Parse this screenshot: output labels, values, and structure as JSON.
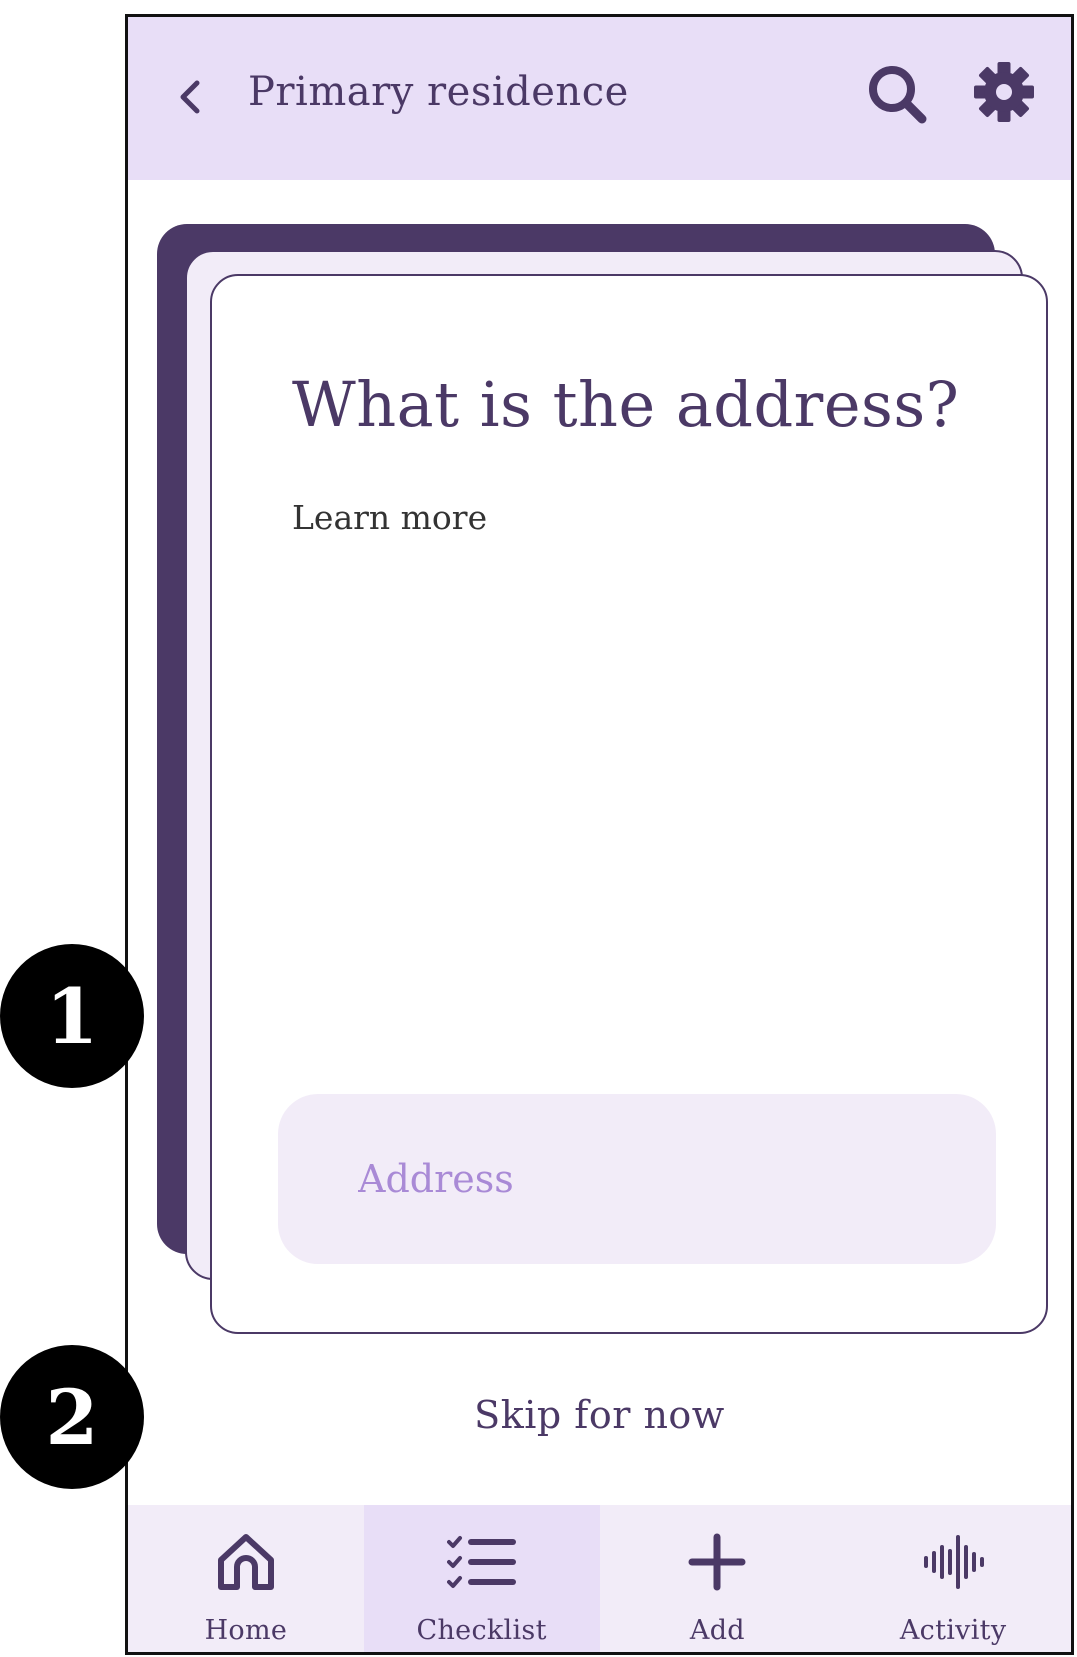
{
  "header": {
    "title": "Primary residence"
  },
  "icons": {
    "back": "chevron-left-icon",
    "search": "search-icon",
    "settings": "gear-icon"
  },
  "card": {
    "question": "What is the address?",
    "learn_more": "Learn more",
    "address_placeholder": "Address"
  },
  "skip": {
    "label": "Skip for now"
  },
  "bottom_nav": {
    "items": [
      {
        "label": "Home",
        "icon": "home-icon",
        "active": false
      },
      {
        "label": "Checklist",
        "icon": "checklist-icon",
        "active": true
      },
      {
        "label": "Add",
        "icon": "plus-icon",
        "active": false
      },
      {
        "label": "Activity",
        "icon": "audio-wave-icon",
        "active": false
      }
    ]
  },
  "annotations": {
    "markers": [
      "1",
      "2"
    ]
  },
  "colors": {
    "primary": "#4b3966",
    "header_bg": "#e8def7",
    "field_bg": "#f2ecf8",
    "placeholder": "#a98ad6"
  }
}
